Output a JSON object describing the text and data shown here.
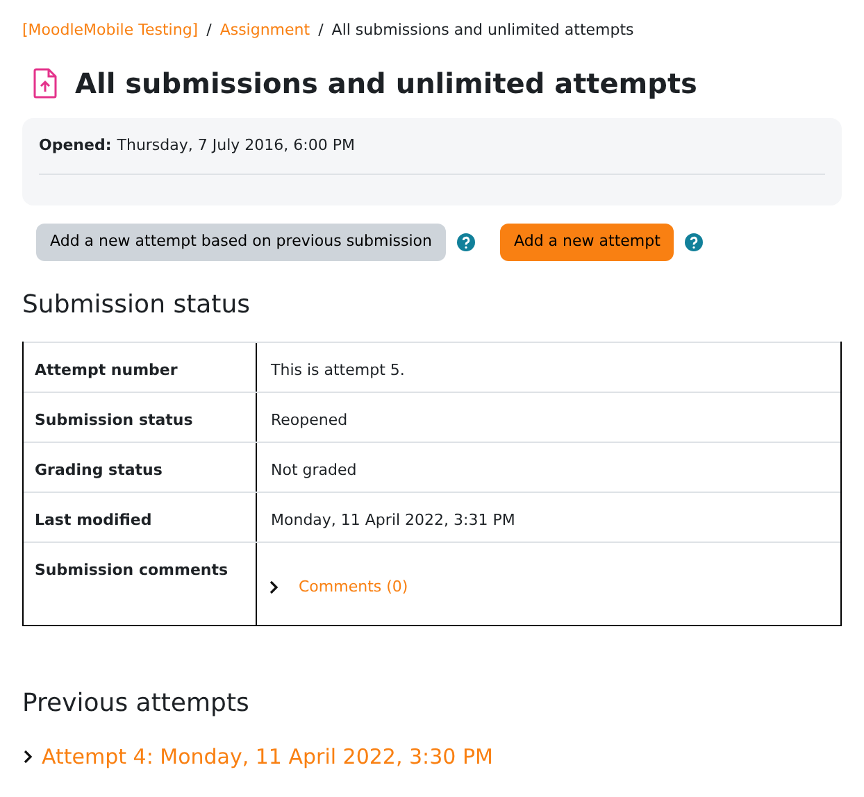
{
  "breadcrumb_separator": "/",
  "breadcrumb": [
    {
      "label": "[MoodleMobile Testing]",
      "link": true
    },
    {
      "label": "Assignment",
      "link": true
    },
    {
      "label": "All submissions and unlimited attempts",
      "link": false
    }
  ],
  "title": "All submissions and unlimited attempts",
  "dates": [
    {
      "label": "Opened:",
      "value": "Thursday, 7 July 2016, 6:00 PM"
    }
  ],
  "buttons": [
    {
      "label": "Add a new attempt based on previous submission",
      "kind": "secondary"
    },
    {
      "label": "Add a new attempt",
      "kind": "primary"
    }
  ],
  "submission_status": {
    "heading": "Submission status",
    "rows": [
      {
        "label": "Attempt number",
        "value": "This is attempt 5.",
        "kind": "text"
      },
      {
        "label": "Submission status",
        "value": "Reopened",
        "kind": "text"
      },
      {
        "label": "Grading status",
        "value": "Not graded",
        "kind": "text"
      },
      {
        "label": "Last modified",
        "value": "Monday, 11 April 2022, 3:31 PM",
        "kind": "text"
      },
      {
        "label": "Submission comments",
        "value": "Comments (0)",
        "kind": "comments",
        "expanded": false
      }
    ]
  },
  "previous_attempts": {
    "heading": "Previous attempts",
    "items": [
      {
        "label": "Attempt 4: Monday, 11 April 2022, 3:30 PM",
        "expanded": false
      }
    ]
  }
}
